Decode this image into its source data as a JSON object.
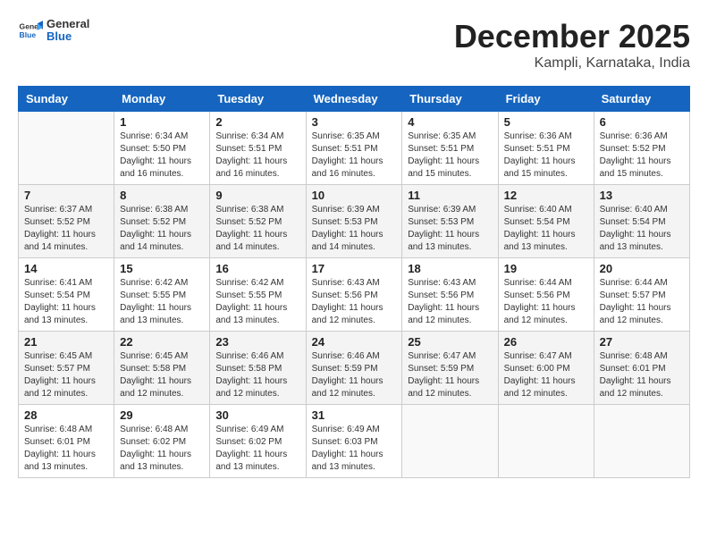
{
  "header": {
    "logo_general": "General",
    "logo_blue": "Blue",
    "month_title": "December 2025",
    "location": "Kampli, Karnataka, India"
  },
  "columns": [
    "Sunday",
    "Monday",
    "Tuesday",
    "Wednesday",
    "Thursday",
    "Friday",
    "Saturday"
  ],
  "weeks": [
    [
      {
        "day": "",
        "info": ""
      },
      {
        "day": "1",
        "info": "Sunrise: 6:34 AM\nSunset: 5:50 PM\nDaylight: 11 hours\nand 16 minutes."
      },
      {
        "day": "2",
        "info": "Sunrise: 6:34 AM\nSunset: 5:51 PM\nDaylight: 11 hours\nand 16 minutes."
      },
      {
        "day": "3",
        "info": "Sunrise: 6:35 AM\nSunset: 5:51 PM\nDaylight: 11 hours\nand 16 minutes."
      },
      {
        "day": "4",
        "info": "Sunrise: 6:35 AM\nSunset: 5:51 PM\nDaylight: 11 hours\nand 15 minutes."
      },
      {
        "day": "5",
        "info": "Sunrise: 6:36 AM\nSunset: 5:51 PM\nDaylight: 11 hours\nand 15 minutes."
      },
      {
        "day": "6",
        "info": "Sunrise: 6:36 AM\nSunset: 5:52 PM\nDaylight: 11 hours\nand 15 minutes."
      }
    ],
    [
      {
        "day": "7",
        "info": "Sunrise: 6:37 AM\nSunset: 5:52 PM\nDaylight: 11 hours\nand 14 minutes."
      },
      {
        "day": "8",
        "info": "Sunrise: 6:38 AM\nSunset: 5:52 PM\nDaylight: 11 hours\nand 14 minutes."
      },
      {
        "day": "9",
        "info": "Sunrise: 6:38 AM\nSunset: 5:52 PM\nDaylight: 11 hours\nand 14 minutes."
      },
      {
        "day": "10",
        "info": "Sunrise: 6:39 AM\nSunset: 5:53 PM\nDaylight: 11 hours\nand 14 minutes."
      },
      {
        "day": "11",
        "info": "Sunrise: 6:39 AM\nSunset: 5:53 PM\nDaylight: 11 hours\nand 13 minutes."
      },
      {
        "day": "12",
        "info": "Sunrise: 6:40 AM\nSunset: 5:54 PM\nDaylight: 11 hours\nand 13 minutes."
      },
      {
        "day": "13",
        "info": "Sunrise: 6:40 AM\nSunset: 5:54 PM\nDaylight: 11 hours\nand 13 minutes."
      }
    ],
    [
      {
        "day": "14",
        "info": "Sunrise: 6:41 AM\nSunset: 5:54 PM\nDaylight: 11 hours\nand 13 minutes."
      },
      {
        "day": "15",
        "info": "Sunrise: 6:42 AM\nSunset: 5:55 PM\nDaylight: 11 hours\nand 13 minutes."
      },
      {
        "day": "16",
        "info": "Sunrise: 6:42 AM\nSunset: 5:55 PM\nDaylight: 11 hours\nand 13 minutes."
      },
      {
        "day": "17",
        "info": "Sunrise: 6:43 AM\nSunset: 5:56 PM\nDaylight: 11 hours\nand 12 minutes."
      },
      {
        "day": "18",
        "info": "Sunrise: 6:43 AM\nSunset: 5:56 PM\nDaylight: 11 hours\nand 12 minutes."
      },
      {
        "day": "19",
        "info": "Sunrise: 6:44 AM\nSunset: 5:56 PM\nDaylight: 11 hours\nand 12 minutes."
      },
      {
        "day": "20",
        "info": "Sunrise: 6:44 AM\nSunset: 5:57 PM\nDaylight: 11 hours\nand 12 minutes."
      }
    ],
    [
      {
        "day": "21",
        "info": "Sunrise: 6:45 AM\nSunset: 5:57 PM\nDaylight: 11 hours\nand 12 minutes."
      },
      {
        "day": "22",
        "info": "Sunrise: 6:45 AM\nSunset: 5:58 PM\nDaylight: 11 hours\nand 12 minutes."
      },
      {
        "day": "23",
        "info": "Sunrise: 6:46 AM\nSunset: 5:58 PM\nDaylight: 11 hours\nand 12 minutes."
      },
      {
        "day": "24",
        "info": "Sunrise: 6:46 AM\nSunset: 5:59 PM\nDaylight: 11 hours\nand 12 minutes."
      },
      {
        "day": "25",
        "info": "Sunrise: 6:47 AM\nSunset: 5:59 PM\nDaylight: 11 hours\nand 12 minutes."
      },
      {
        "day": "26",
        "info": "Sunrise: 6:47 AM\nSunset: 6:00 PM\nDaylight: 11 hours\nand 12 minutes."
      },
      {
        "day": "27",
        "info": "Sunrise: 6:48 AM\nSunset: 6:01 PM\nDaylight: 11 hours\nand 12 minutes."
      }
    ],
    [
      {
        "day": "28",
        "info": "Sunrise: 6:48 AM\nSunset: 6:01 PM\nDaylight: 11 hours\nand 13 minutes."
      },
      {
        "day": "29",
        "info": "Sunrise: 6:48 AM\nSunset: 6:02 PM\nDaylight: 11 hours\nand 13 minutes."
      },
      {
        "day": "30",
        "info": "Sunrise: 6:49 AM\nSunset: 6:02 PM\nDaylight: 11 hours\nand 13 minutes."
      },
      {
        "day": "31",
        "info": "Sunrise: 6:49 AM\nSunset: 6:03 PM\nDaylight: 11 hours\nand 13 minutes."
      },
      {
        "day": "",
        "info": ""
      },
      {
        "day": "",
        "info": ""
      },
      {
        "day": "",
        "info": ""
      }
    ]
  ]
}
